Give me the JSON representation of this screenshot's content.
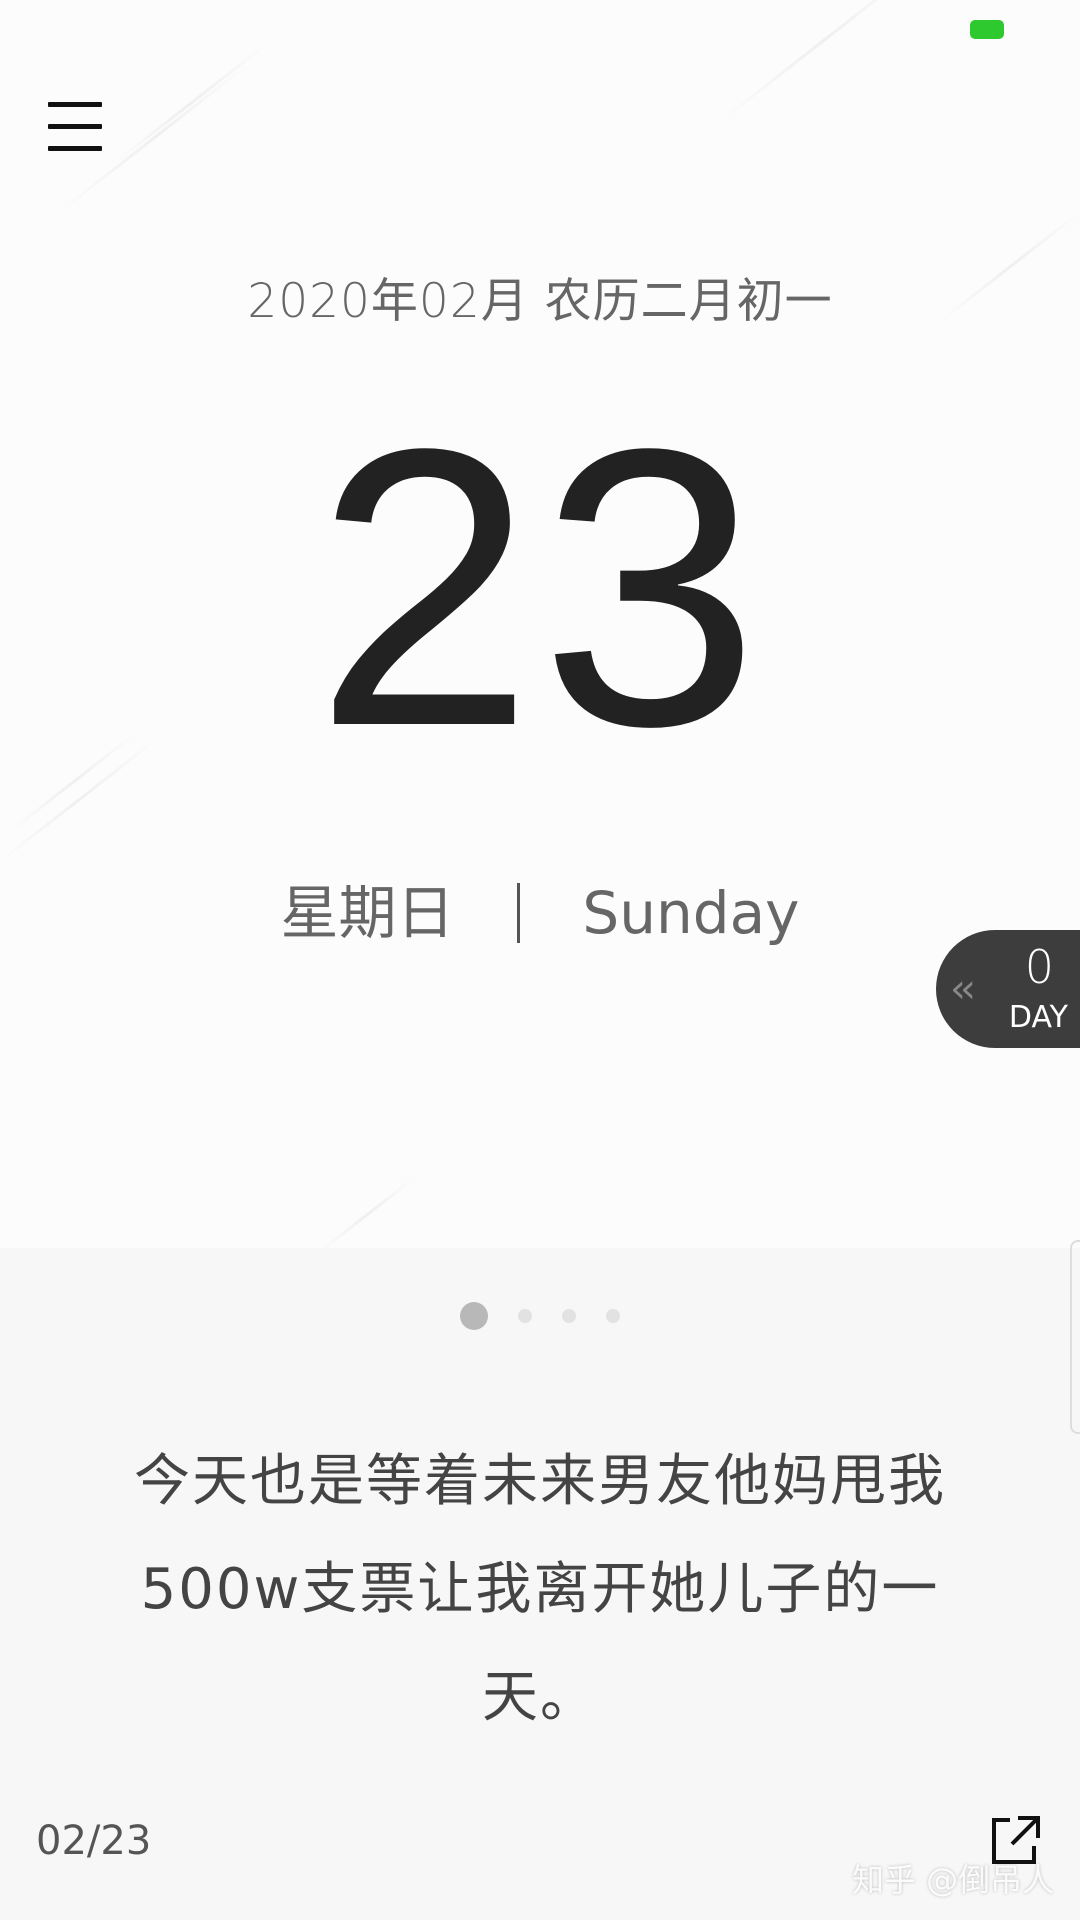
{
  "header": {
    "date_line": "2020年02月  农历二月初一"
  },
  "calendar": {
    "day_number": "23",
    "weekday_cn": "星期日",
    "weekday_en": "Sunday"
  },
  "day_counter": {
    "chevron": "‹‹",
    "count": "0",
    "unit": "DAY"
  },
  "pager": {
    "pages": 4,
    "active": 1
  },
  "quote": {
    "text": "今天也是等着未来男友他妈甩我500w支票让我离开她儿子的一天。"
  },
  "footer": {
    "date_short": "02/23"
  },
  "watermark": "知乎 @倒吊人",
  "icons": {
    "menu": "hamburger-menu-icon",
    "share": "share-external-icon"
  },
  "colors": {
    "battery": "#2ec92e",
    "counter_bg": "#3d3d3d"
  }
}
